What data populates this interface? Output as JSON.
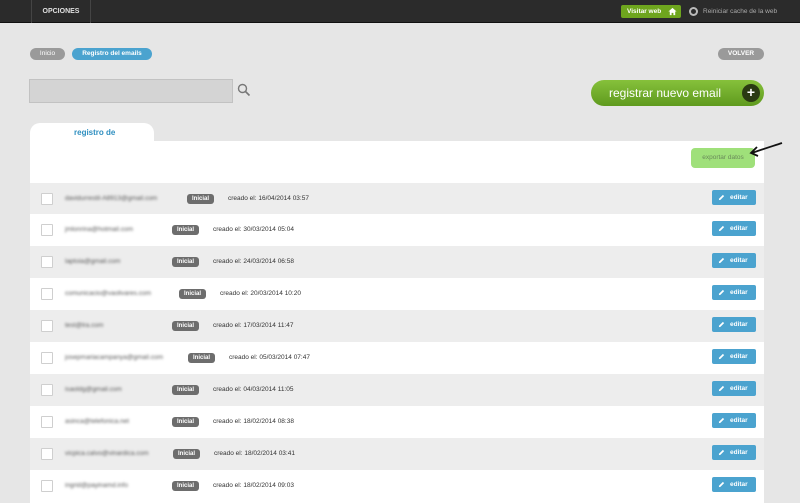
{
  "topbar": {
    "opciones": "OPCIONES",
    "visitar_web": "Visitar web",
    "reiniciar_cache": "Reiniciar cache de la web"
  },
  "breadcrumb": {
    "inicio": "Inicio",
    "current": "Registro del emails",
    "volver": "VOLVER"
  },
  "search": {
    "placeholder": ""
  },
  "new_email_button": "registrar nuevo email",
  "tab_label": "registro de",
  "export_label": "exportar datos",
  "edit_label": "editar",
  "colors": {
    "accent_green": "#6ea51e",
    "accent_blue": "#4ba3cf",
    "badge_gray": "#6d6d6d"
  },
  "rows": [
    {
      "email": "davidurrestil-A8913@gmail.com",
      "status": "Inicial",
      "created": "creado el: 16/04/2014 03:57"
    },
    {
      "email": "jmlonrina@hotmail.com",
      "status": "Inicial",
      "created": "creado el: 30/03/2014 05:04"
    },
    {
      "email": "laptoia@gmail.com",
      "status": "Inicial",
      "created": "creado el: 24/03/2014 06:58"
    },
    {
      "email": "comunicacio@vaolivares.com",
      "status": "Inicial",
      "created": "creado el: 20/03/2014 10:20"
    },
    {
      "email": "test@lra.com",
      "status": "Inicial",
      "created": "creado el: 17/03/2014 11:47"
    },
    {
      "email": "josepmariacampanya@gmail.com",
      "status": "Inicial",
      "created": "creado el: 05/03/2014 07:47"
    },
    {
      "email": "isaoldg@gmail.com",
      "status": "Inicial",
      "created": "creado el: 04/03/2014 11:05"
    },
    {
      "email": "asinca@telefonica.net",
      "status": "Inicial",
      "created": "creado el: 18/02/2014 08:38"
    },
    {
      "email": "vicpica.calvo@vinardica.com",
      "status": "Inicial",
      "created": "creado el: 18/02/2014 03:41"
    },
    {
      "email": "ingrid@payinamd.info",
      "status": "Inicial",
      "created": "creado el: 18/02/2014 09:03"
    }
  ]
}
